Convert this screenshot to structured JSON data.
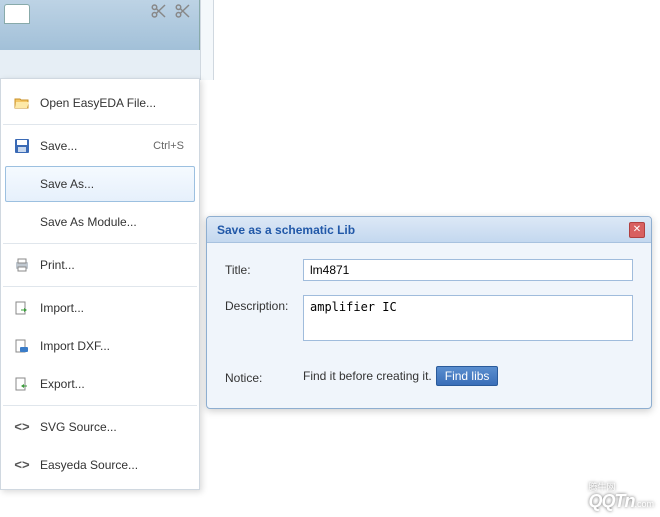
{
  "menu": {
    "open": "Open EasyEDA File...",
    "save": "Save...",
    "save_shortcut": "Ctrl+S",
    "save_as": "Save As...",
    "save_as_module": "Save As Module...",
    "print": "Print...",
    "import": "Import...",
    "import_dxf": "Import DXF...",
    "export": "Export...",
    "svg_source": "SVG Source...",
    "easyeda_source": "Easyeda Source..."
  },
  "dialog": {
    "title": "Save as a schematic Lib",
    "title_label": "Title:",
    "title_value": "lm4871",
    "description_label": "Description:",
    "description_value": "amplifier IC",
    "notice_label": "Notice:",
    "notice_text": "Find it before creating it.",
    "find_button": "Find libs"
  },
  "watermark": {
    "label": "腾牛网",
    "brand": "QQTn",
    "domain": ".com"
  }
}
